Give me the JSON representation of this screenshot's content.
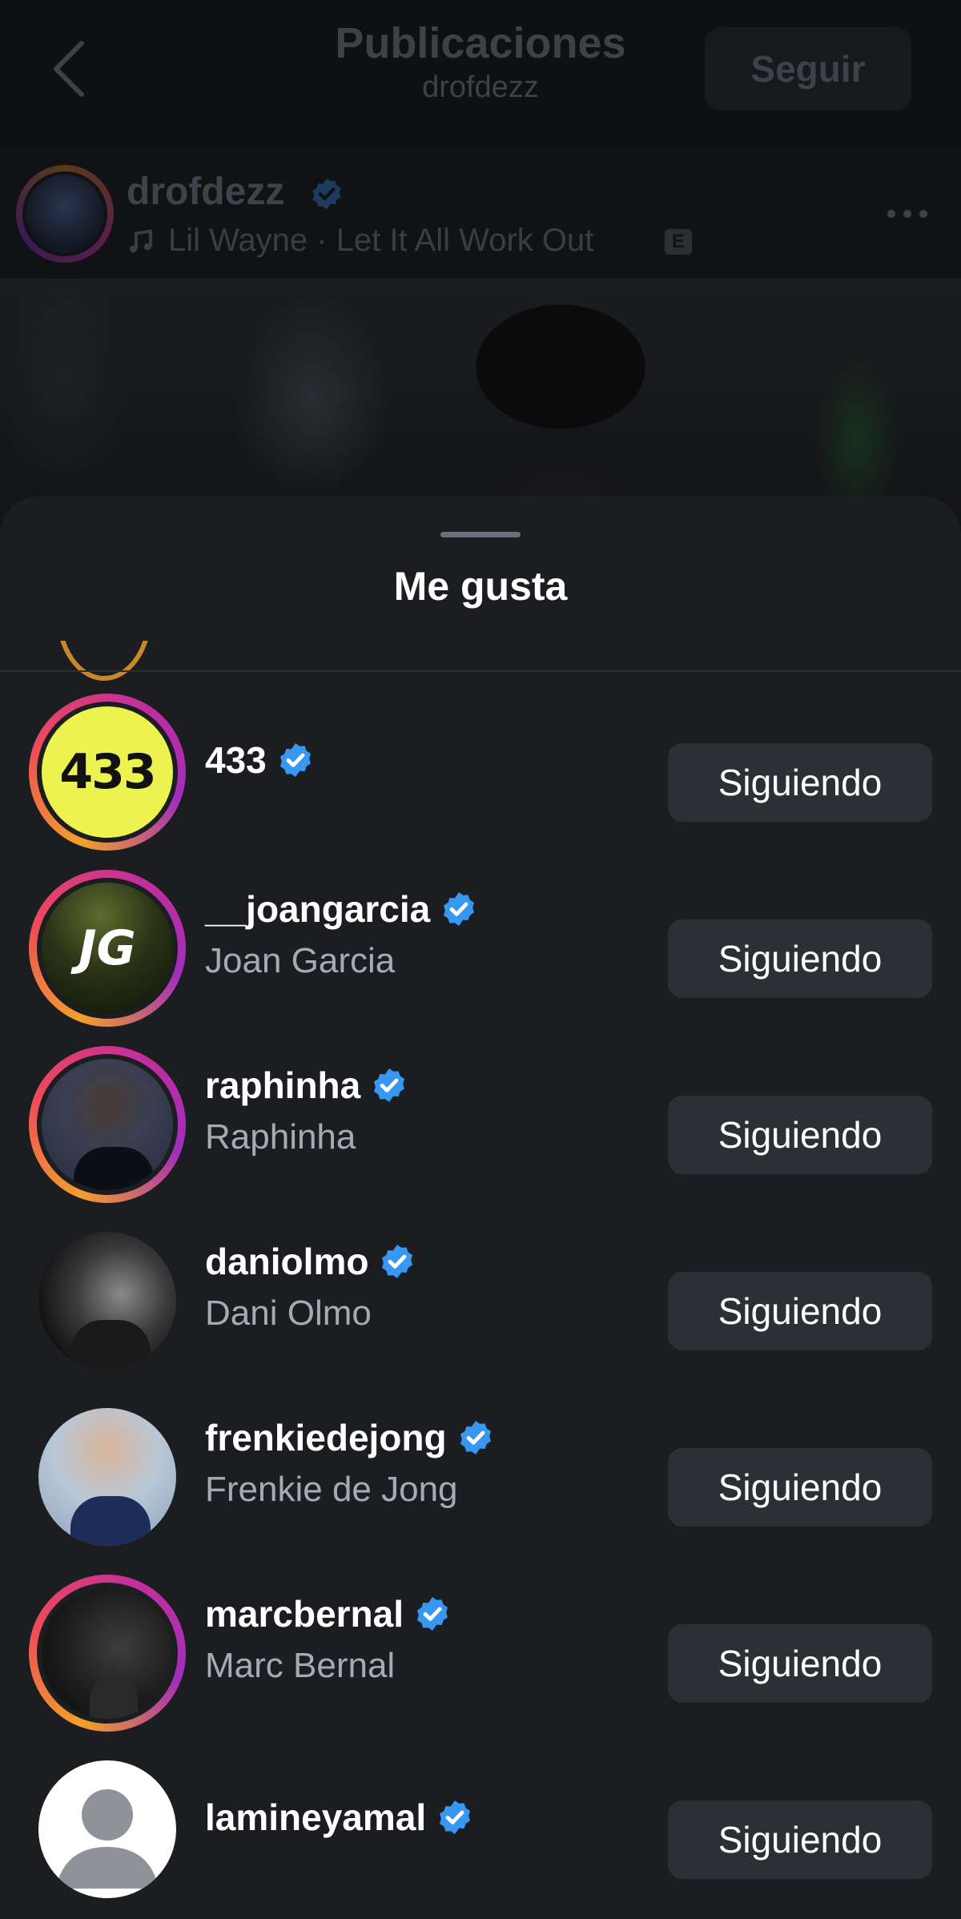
{
  "header": {
    "title": "Publicaciones",
    "subtitle": "drofdezz",
    "follow_label": "Seguir"
  },
  "post": {
    "username": "drofdezz",
    "music": "Lil Wayne · Let It All Work Out",
    "explicit_badge": "E"
  },
  "sheet": {
    "title": "Me gusta",
    "users": [
      {
        "username": "433",
        "full_name": "",
        "button": "Siguiendo",
        "avatar": "433-logo-avatar",
        "avatar_text": "433"
      },
      {
        "username": "__joangarcia",
        "full_name": "Joan Garcia",
        "button": "Siguiendo",
        "avatar": "jg-logo-avatar",
        "avatar_text": "JG"
      },
      {
        "username": "raphinha",
        "full_name": "Raphinha",
        "button": "Siguiendo",
        "avatar": "photo-avatar"
      },
      {
        "username": "daniolmo",
        "full_name": "Dani Olmo",
        "button": "Siguiendo",
        "avatar": "photo-avatar"
      },
      {
        "username": "frenkiedejong",
        "full_name": "Frenkie de Jong",
        "button": "Siguiendo",
        "avatar": "photo-avatar"
      },
      {
        "username": "marcbernal",
        "full_name": "Marc Bernal",
        "button": "Siguiendo",
        "avatar": "photo-avatar"
      },
      {
        "username": "lamineyamal",
        "full_name": "",
        "button": "Siguiendo",
        "avatar": "default-avatar"
      }
    ]
  },
  "colors": {
    "verified": "#3897f0",
    "button_bg": "#2c2f34",
    "sheet_bg": "#1b1d21"
  }
}
